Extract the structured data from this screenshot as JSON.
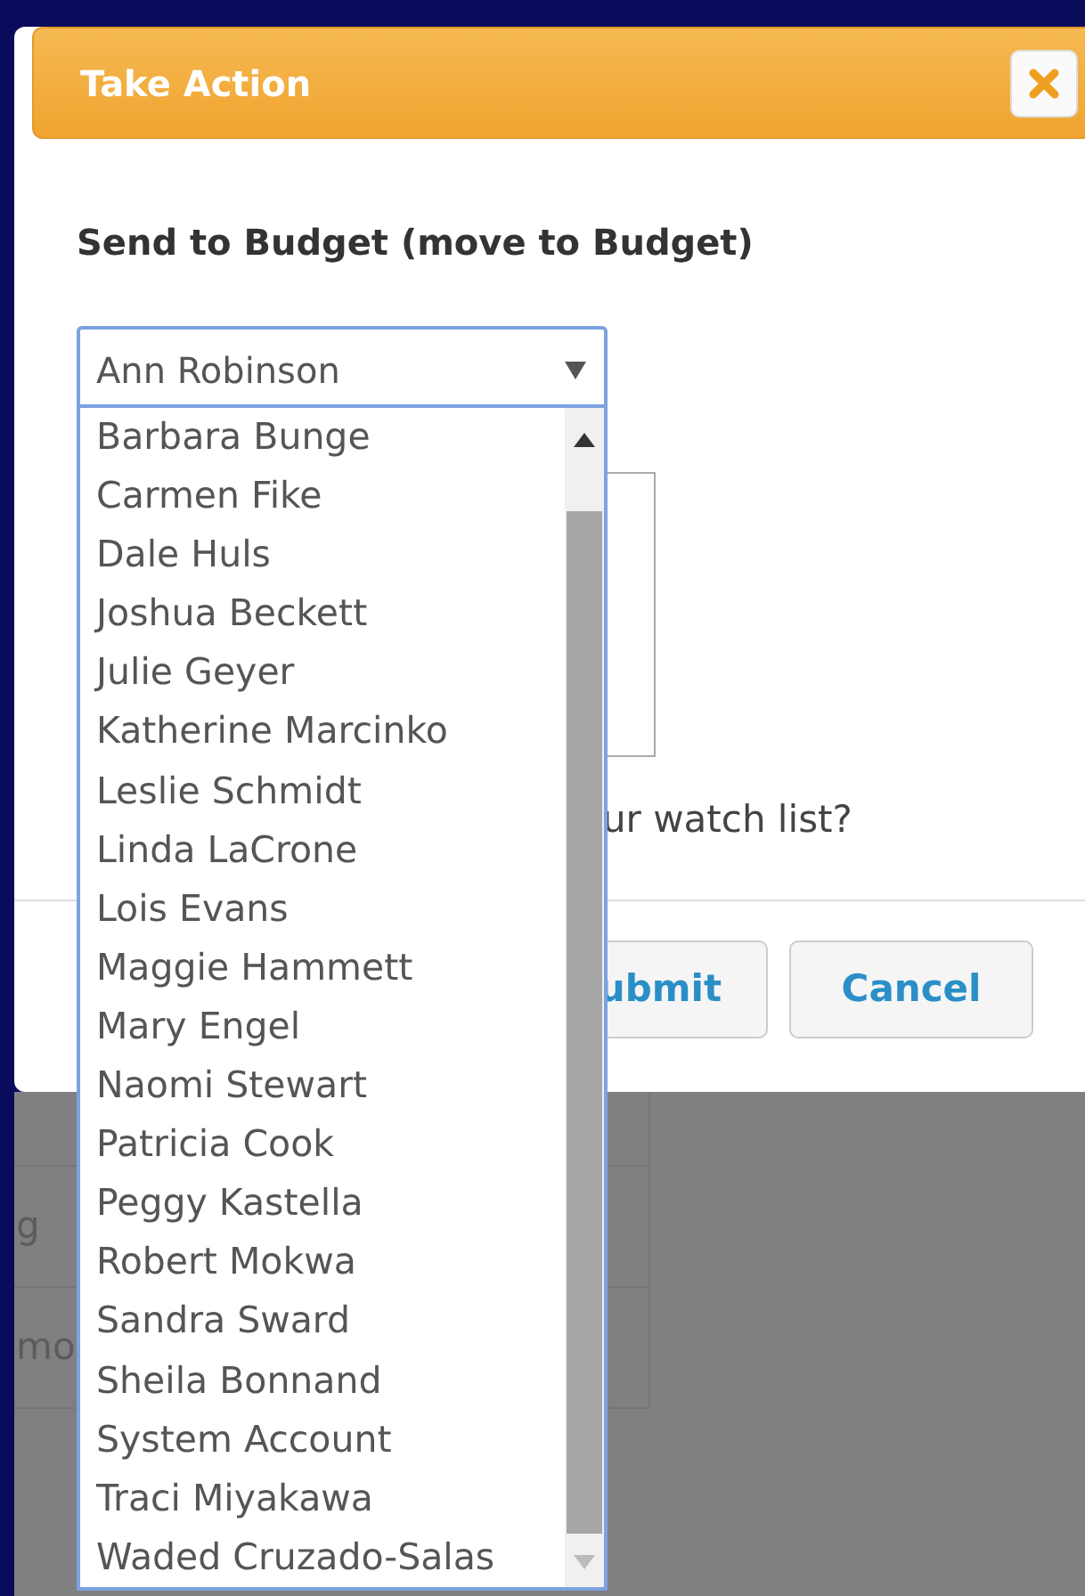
{
  "dialog": {
    "title": "Take Action",
    "prompt": "Send to Budget (move to Budget)",
    "select": {
      "value": "Ann Robinson",
      "expanded": true
    },
    "options": [
      "Barbara Bunge",
      "Carmen Fike",
      "Dale Huls",
      "Joshua Beckett",
      "Julie Geyer",
      "Katherine Marcinko",
      "Leslie Schmidt",
      "Linda LaCrone",
      "Lois Evans",
      "Maggie Hammett",
      "Mary Engel",
      "Naomi Stewart",
      "Patricia Cook",
      "Peggy Kastella",
      "Robert Mokwa",
      "Sandra Sward",
      "Sheila Bonnand",
      "System Account",
      "Traci Miyakawa",
      "Waded Cruzado-Salas"
    ],
    "watch_text": "ur watch list?",
    "buttons": [
      {
        "label": "ubmit"
      },
      {
        "label": "Cancel"
      }
    ]
  },
  "background_texts": [
    "g",
    "mo"
  ]
}
